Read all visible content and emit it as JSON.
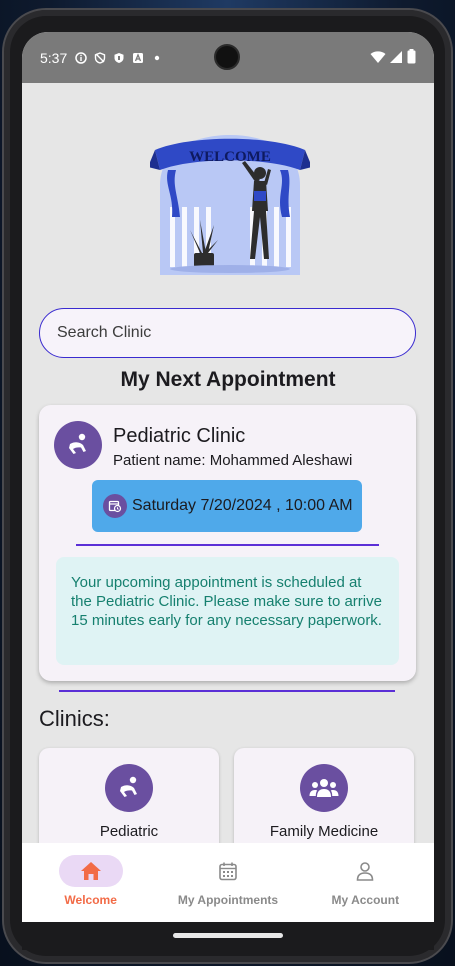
{
  "status_bar": {
    "time": "5:37",
    "icons": [
      "info-icon",
      "shield-outline-icon",
      "shield-icon",
      "a-icon",
      "dot-icon"
    ],
    "right_icons": [
      "wifi-icon",
      "signal-icon",
      "battery-icon"
    ]
  },
  "hero": {
    "banner_text": "WELCOME"
  },
  "search": {
    "placeholder": "Search Clinic"
  },
  "next_appointment": {
    "section_title": "My Next Appointment",
    "clinic_name": "Pediatric Clinic",
    "patient_label": "Patient name: Mohammed Aleshawi",
    "date_text": "Saturday 7/20/2024 , 10:00 AM",
    "note": "Your upcoming appointment is scheduled at the Pediatric Clinic. Please make sure to arrive 15 minutes early for any necessary paperwork."
  },
  "clinics": {
    "label": "Clinics:",
    "items": [
      {
        "label": "Pediatric",
        "icon": "baby-crawl-icon"
      },
      {
        "label": "Family Medicine",
        "icon": "family-icon"
      }
    ]
  },
  "bottom_nav": {
    "items": [
      {
        "label": "Welcome",
        "icon": "home-icon",
        "active": true
      },
      {
        "label": "My Appointments",
        "icon": "calendar-icon",
        "active": false
      },
      {
        "label": "My Account",
        "icon": "person-icon",
        "active": false
      }
    ]
  },
  "colors": {
    "accent_purple": "#6a4fa0",
    "active_nav": "#f26b47",
    "date_chip": "#4fa9ea",
    "note_text": "#16806f",
    "note_bg": "#dff3f4",
    "divider": "#5b2fd6"
  }
}
